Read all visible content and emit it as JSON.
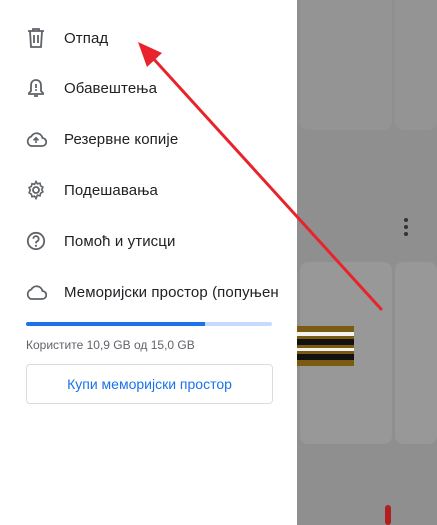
{
  "menu": {
    "items": [
      {
        "label": "Отпад",
        "icon": "trash-icon"
      },
      {
        "label": "Обавештења",
        "icon": "bell-icon"
      },
      {
        "label": "Резервне копије",
        "icon": "cloud-upload-icon"
      },
      {
        "label": "Подешавања",
        "icon": "gear-icon"
      },
      {
        "label": "Помоћ и утисци",
        "icon": "help-icon"
      },
      {
        "label": "Меморијски простор (попуњен",
        "icon": "cloud-icon"
      }
    ]
  },
  "storage": {
    "used_text": "Користите 10,9 GB од 15,0 GB",
    "used_fraction": 0.7267,
    "buy_label": "Купи меморијски простор"
  },
  "colors": {
    "accent": "#1a73e8",
    "bar_track": "#c6dafc",
    "arrow": "#e8232b"
  }
}
